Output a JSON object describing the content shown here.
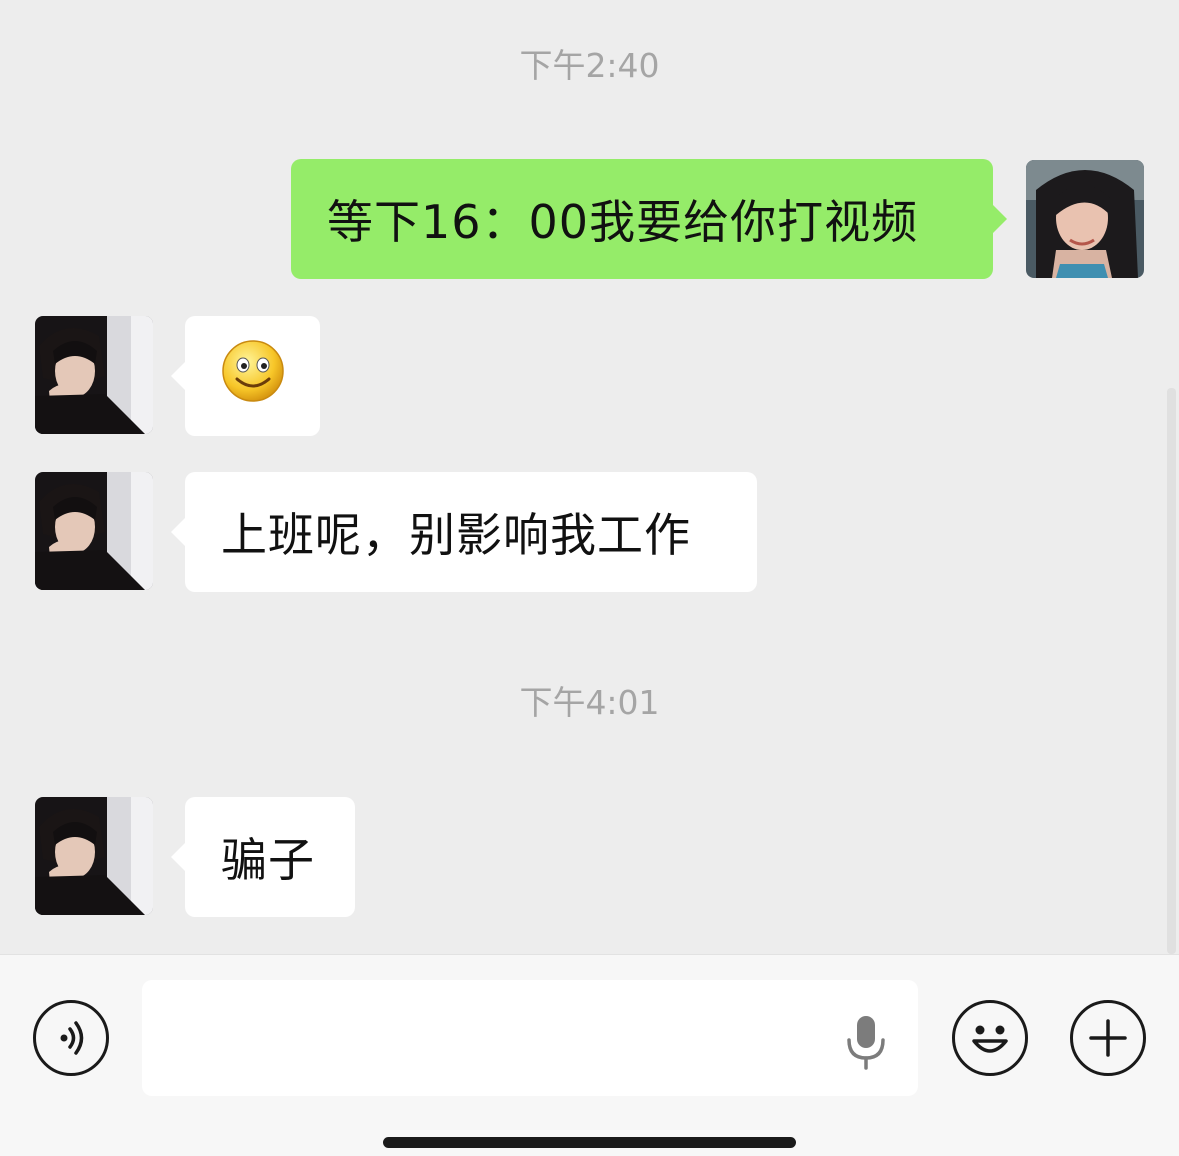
{
  "chat": {
    "timestamps": [
      "下午2:40",
      "下午4:01"
    ],
    "messages": [
      {
        "sender": "self",
        "type": "text",
        "text": "等下16：00我要给你打视频"
      },
      {
        "sender": "contact",
        "type": "emoji",
        "emoji": "smile-emoji"
      },
      {
        "sender": "contact",
        "type": "text",
        "text": "上班呢，别影响我工作"
      },
      {
        "sender": "contact",
        "type": "text",
        "text": "骗子"
      }
    ]
  },
  "input_bar": {
    "text_value": "",
    "voice_icon": "voice-toggle-icon",
    "mic_icon": "microphone-icon",
    "emoji_icon": "emoji-icon",
    "plus_icon": "plus-icon"
  },
  "colors": {
    "background": "#ededed",
    "self_bubble": "#95ec69",
    "contact_bubble": "#ffffff",
    "timestamp_text": "#a5a5a5"
  }
}
